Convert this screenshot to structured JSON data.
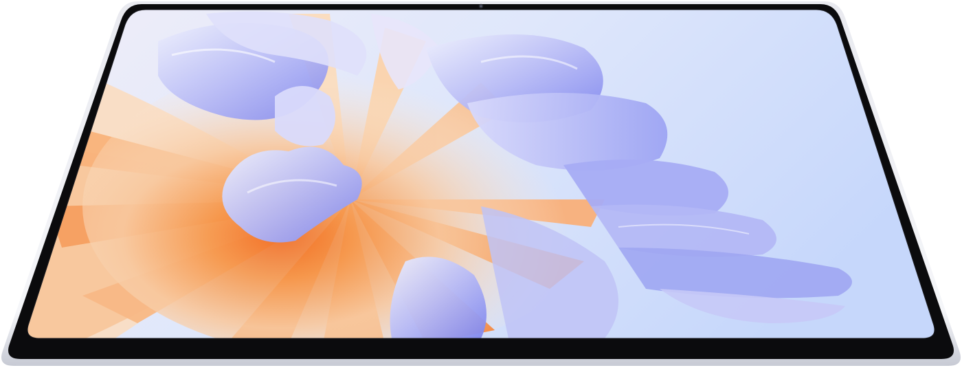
{
  "scene": {
    "subject": "tablet-device",
    "wallpaper": "abstract-flower-petals"
  },
  "colors": {
    "background": "#ffffff",
    "bezel": "#0b0b0d",
    "frame_light": "#f2f3f7",
    "frame_shadow": "#c9ccd6",
    "screen_sky_top": "#e6ecfb",
    "screen_sky_right": "#c9d9fb",
    "petal_orange": "#f5893a",
    "petal_peach": "#f8c9a0",
    "petal_cream": "#fbe6cf",
    "petal_lilac": "#b7b7f4",
    "petal_violet": "#8c8ff0",
    "petal_white": "#eef0fd"
  }
}
